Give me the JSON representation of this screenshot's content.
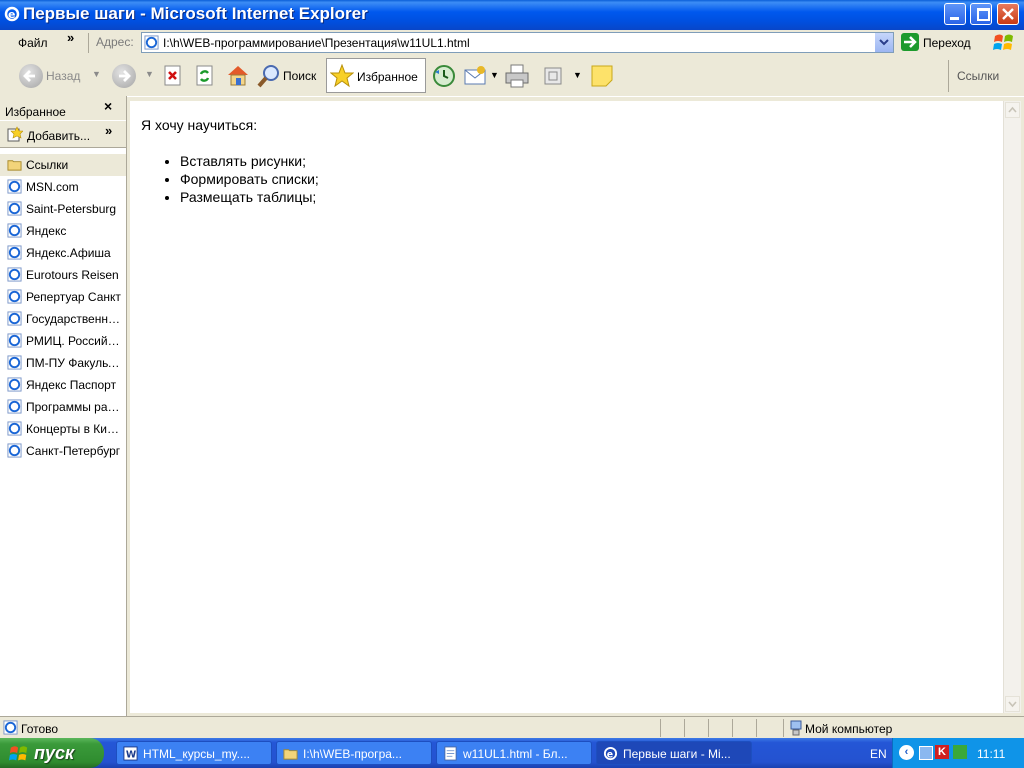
{
  "window": {
    "title": "Первые шаги - Microsoft Internet Explorer"
  },
  "menu": {
    "file": "Файл",
    "chevron": "»",
    "address_label": "Адрес:",
    "address_value": "I:\\h\\WEB-программирование\\Презентация\\w11UL1.html",
    "go": "Переход"
  },
  "toolbar": {
    "back": "Назад",
    "search": "Поиск",
    "favorites": "Избранное",
    "links": "Ссылки"
  },
  "favorites_pane": {
    "title": "Избранное",
    "close": "×",
    "add": "Добавить...",
    "chevron": "»",
    "items": [
      {
        "label": "Ссылки",
        "type": "folder"
      },
      {
        "label": "MSN.com",
        "type": "link"
      },
      {
        "label": "Saint-Petersburg",
        "type": "link"
      },
      {
        "label": "Яндекс",
        "type": "link"
      },
      {
        "label": "Яндекс.Афиша",
        "type": "link"
      },
      {
        "label": "Eurotours Reisen",
        "type": "link"
      },
      {
        "label": "Репертуар Санкт",
        "type": "link"
      },
      {
        "label": "Государственный",
        "type": "link"
      },
      {
        "label": "РМИЦ. Российский",
        "type": "link"
      },
      {
        "label": "ПМ-ПУ  Факультет",
        "type": "link"
      },
      {
        "label": "Яндекс Паспорт",
        "type": "link"
      },
      {
        "label": "Программы радио",
        "type": "link"
      },
      {
        "label": "Концерты в Киеве",
        "type": "link"
      },
      {
        "label": "Санкт-Петербург",
        "type": "link"
      }
    ]
  },
  "content": {
    "intro": "Я хочу научиться:",
    "bullets": [
      "Вставлять рисунки;",
      "Формировать списки;",
      "Размещать таблицы;"
    ]
  },
  "status": {
    "text": "Готово",
    "zone": "Мой компьютер"
  },
  "taskbar": {
    "start": "пуск",
    "tasks": [
      {
        "label": "HTML_курсы_my....",
        "active": false
      },
      {
        "label": "I:\\h\\WEB-програ...",
        "active": false
      },
      {
        "label": "w11UL1.html - Бл...",
        "active": false
      },
      {
        "label": "Первые шаги - Mi...",
        "active": true
      }
    ],
    "lang": "EN",
    "clock": "11:11"
  }
}
